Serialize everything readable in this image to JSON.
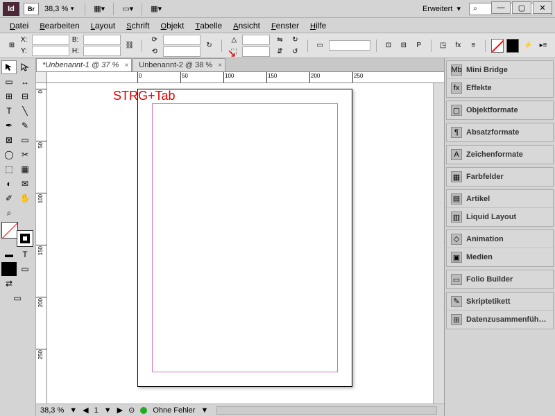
{
  "titlebar": {
    "app_id": "Id",
    "bridge": "Br",
    "zoom": "38,3 %",
    "workspace": "Erweitert",
    "search_placeholder": ""
  },
  "menu": {
    "items": [
      "Datei",
      "Bearbeiten",
      "Layout",
      "Schrift",
      "Objekt",
      "Tabelle",
      "Ansicht",
      "Fenster",
      "Hilfe"
    ]
  },
  "control": {
    "x_label": "X:",
    "y_label": "Y:",
    "w_label": "B:",
    "h_label": "H:"
  },
  "tabs": [
    {
      "label": "*Unbenannt-1 @ 37 %",
      "active": true
    },
    {
      "label": "Unbenannt-2 @ 38 %",
      "active": false
    }
  ],
  "ruler_h": [
    0,
    50,
    100,
    150,
    200,
    250
  ],
  "ruler_v": [
    0,
    50,
    100,
    150,
    200,
    250
  ],
  "annotation": "STRG+Tab",
  "status": {
    "zoom": "38,3 %",
    "page": "1",
    "preflight": "Ohne Fehler"
  },
  "panels": [
    {
      "group": [
        {
          "icon": "Mb",
          "label": "Mini Bridge"
        },
        {
          "icon": "fx",
          "label": "Effekte"
        }
      ]
    },
    {
      "group": [
        {
          "icon": "▢",
          "label": "Objektformate"
        }
      ]
    },
    {
      "group": [
        {
          "icon": "¶",
          "label": "Absatzformate"
        }
      ]
    },
    {
      "group": [
        {
          "icon": "A",
          "label": "Zeichenformate"
        }
      ]
    },
    {
      "group": [
        {
          "icon": "▦",
          "label": "Farbfelder"
        }
      ]
    },
    {
      "group": [
        {
          "icon": "▤",
          "label": "Artikel"
        },
        {
          "icon": "▥",
          "label": "Liquid Layout"
        }
      ]
    },
    {
      "group": [
        {
          "icon": "◇",
          "label": "Animation"
        },
        {
          "icon": "▣",
          "label": "Medien"
        }
      ]
    },
    {
      "group": [
        {
          "icon": "▭",
          "label": "Folio Builder"
        }
      ]
    },
    {
      "group": [
        {
          "icon": "✎",
          "label": "Skriptetikett"
        },
        {
          "icon": "⊞",
          "label": "Datenzusammenfüh…"
        }
      ]
    }
  ]
}
